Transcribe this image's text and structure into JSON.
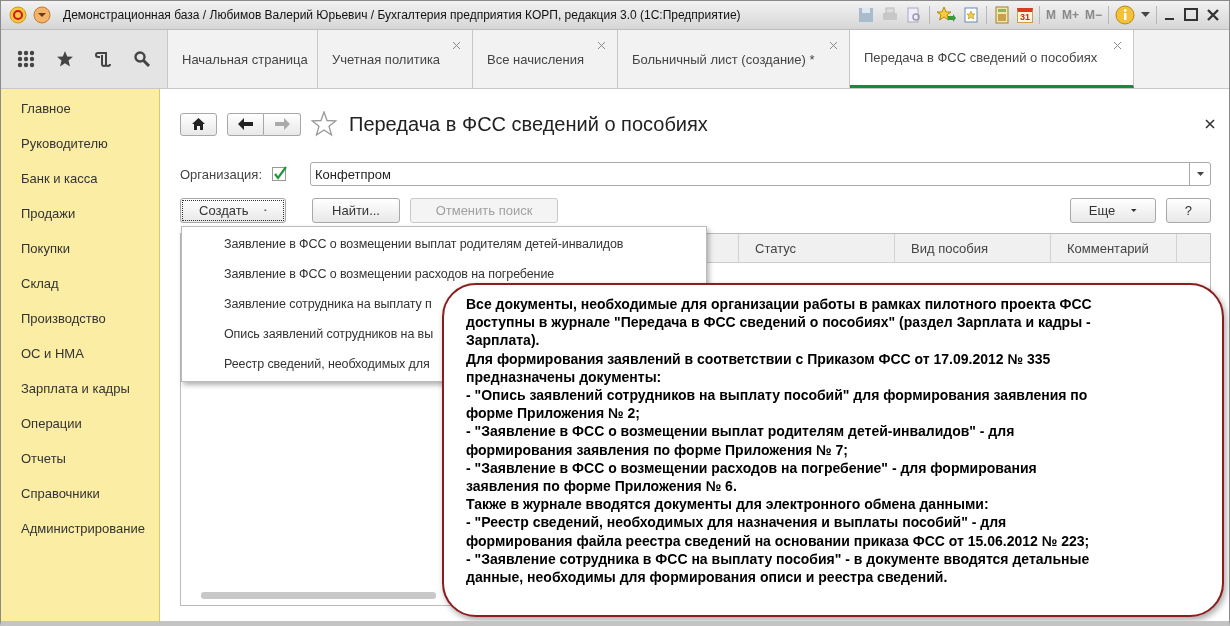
{
  "window": {
    "title": "Демонстрационная база / Любимов Валерий Юрьевич / Бухгалтерия предприятия КОРП, редакция 3.0  (1С:Предприятие)",
    "calendar_day": "31",
    "memory_buttons": [
      "M",
      "M+",
      "M−"
    ]
  },
  "nav_tabs": [
    {
      "label": "Начальная страница",
      "selected": false,
      "closable": false
    },
    {
      "label": "Учетная политика",
      "selected": false,
      "closable": true
    },
    {
      "label": "Все начисления",
      "selected": false,
      "closable": true
    },
    {
      "label": "Больничный лист (создание) *",
      "selected": false,
      "closable": true
    },
    {
      "label": "Передача в ФСС сведений о пособиях",
      "selected": true,
      "closable": true
    }
  ],
  "sidebar": {
    "items": [
      "Главное",
      "Руководителю",
      "Банк и касса",
      "Продажи",
      "Покупки",
      "Склад",
      "Производство",
      "ОС и НМА",
      "Зарплата и кадры",
      "Операции",
      "Отчеты",
      "Справочники",
      "Администрирование"
    ]
  },
  "page": {
    "title": "Передача в ФСС сведений о пособиях",
    "organization": {
      "label": "Организация:",
      "checked": true,
      "value": "Конфетпром"
    },
    "left_buttons": [
      {
        "label": "Создать",
        "kind": "dropdown",
        "disabled": false
      },
      {
        "label": "Найти...",
        "kind": "plain",
        "disabled": false
      },
      {
        "label": "Отменить поиск",
        "kind": "plain",
        "disabled": true
      }
    ],
    "right_buttons": [
      {
        "label": "Еще",
        "kind": "dropdown",
        "disabled": false
      },
      {
        "label": "?",
        "kind": "plain",
        "disabled": false
      }
    ]
  },
  "create_menu": {
    "items": [
      "Заявление в ФСС о возмещении выплат родителям детей-инвалидов",
      "Заявление в ФСС о возмещении расходов на погребение",
      "Заявление сотрудника на выплату п",
      "Опись заявлений сотрудников на вы",
      "Реестр сведений, необходимых для"
    ]
  },
  "table": {
    "columns": [
      "Статус",
      "Вид пособия",
      "Комментарий"
    ]
  },
  "callout": {
    "lines": [
      "Все документы, необходимые для организации работы в рамках пилотного проекта ФСС",
      "доступны в журнале \"Передача в ФСС сведений о пособиях\" (раздел Зарплата и кадры -",
      "Зарплата).",
      "Для формирования заявлений в соответствии с Приказом ФСС от 17.09.2012 № 335",
      "предназначены документы:",
      "- \"Опись заявлений сотрудников на выплату пособий\" для формирования заявления по",
      "форме Приложения № 2;",
      "- \"Заявление в ФСС о возмещении выплат родителям детей-инвалидов\" -  для",
      "формирования заявления по форме Приложения № 7;",
      "- \"Заявление в ФСС о возмещении расходов на погребение\" - для формирования",
      "заявления по форме Приложения № 6.",
      "Также в журнале вводятся документы для электронного обмена данными:",
      "- \"Реестр сведений, необходимых для назначения и выплаты пособий\" - для",
      "формирования файла реестра сведений на основании приказа ФСС от 15.06.2012 № 223;",
      "- \"Заявление сотрудника в ФСС на выплату пособия\" - в документе вводятся детальные",
      "данные, необходимы для формирования описи и реестра сведений."
    ]
  }
}
